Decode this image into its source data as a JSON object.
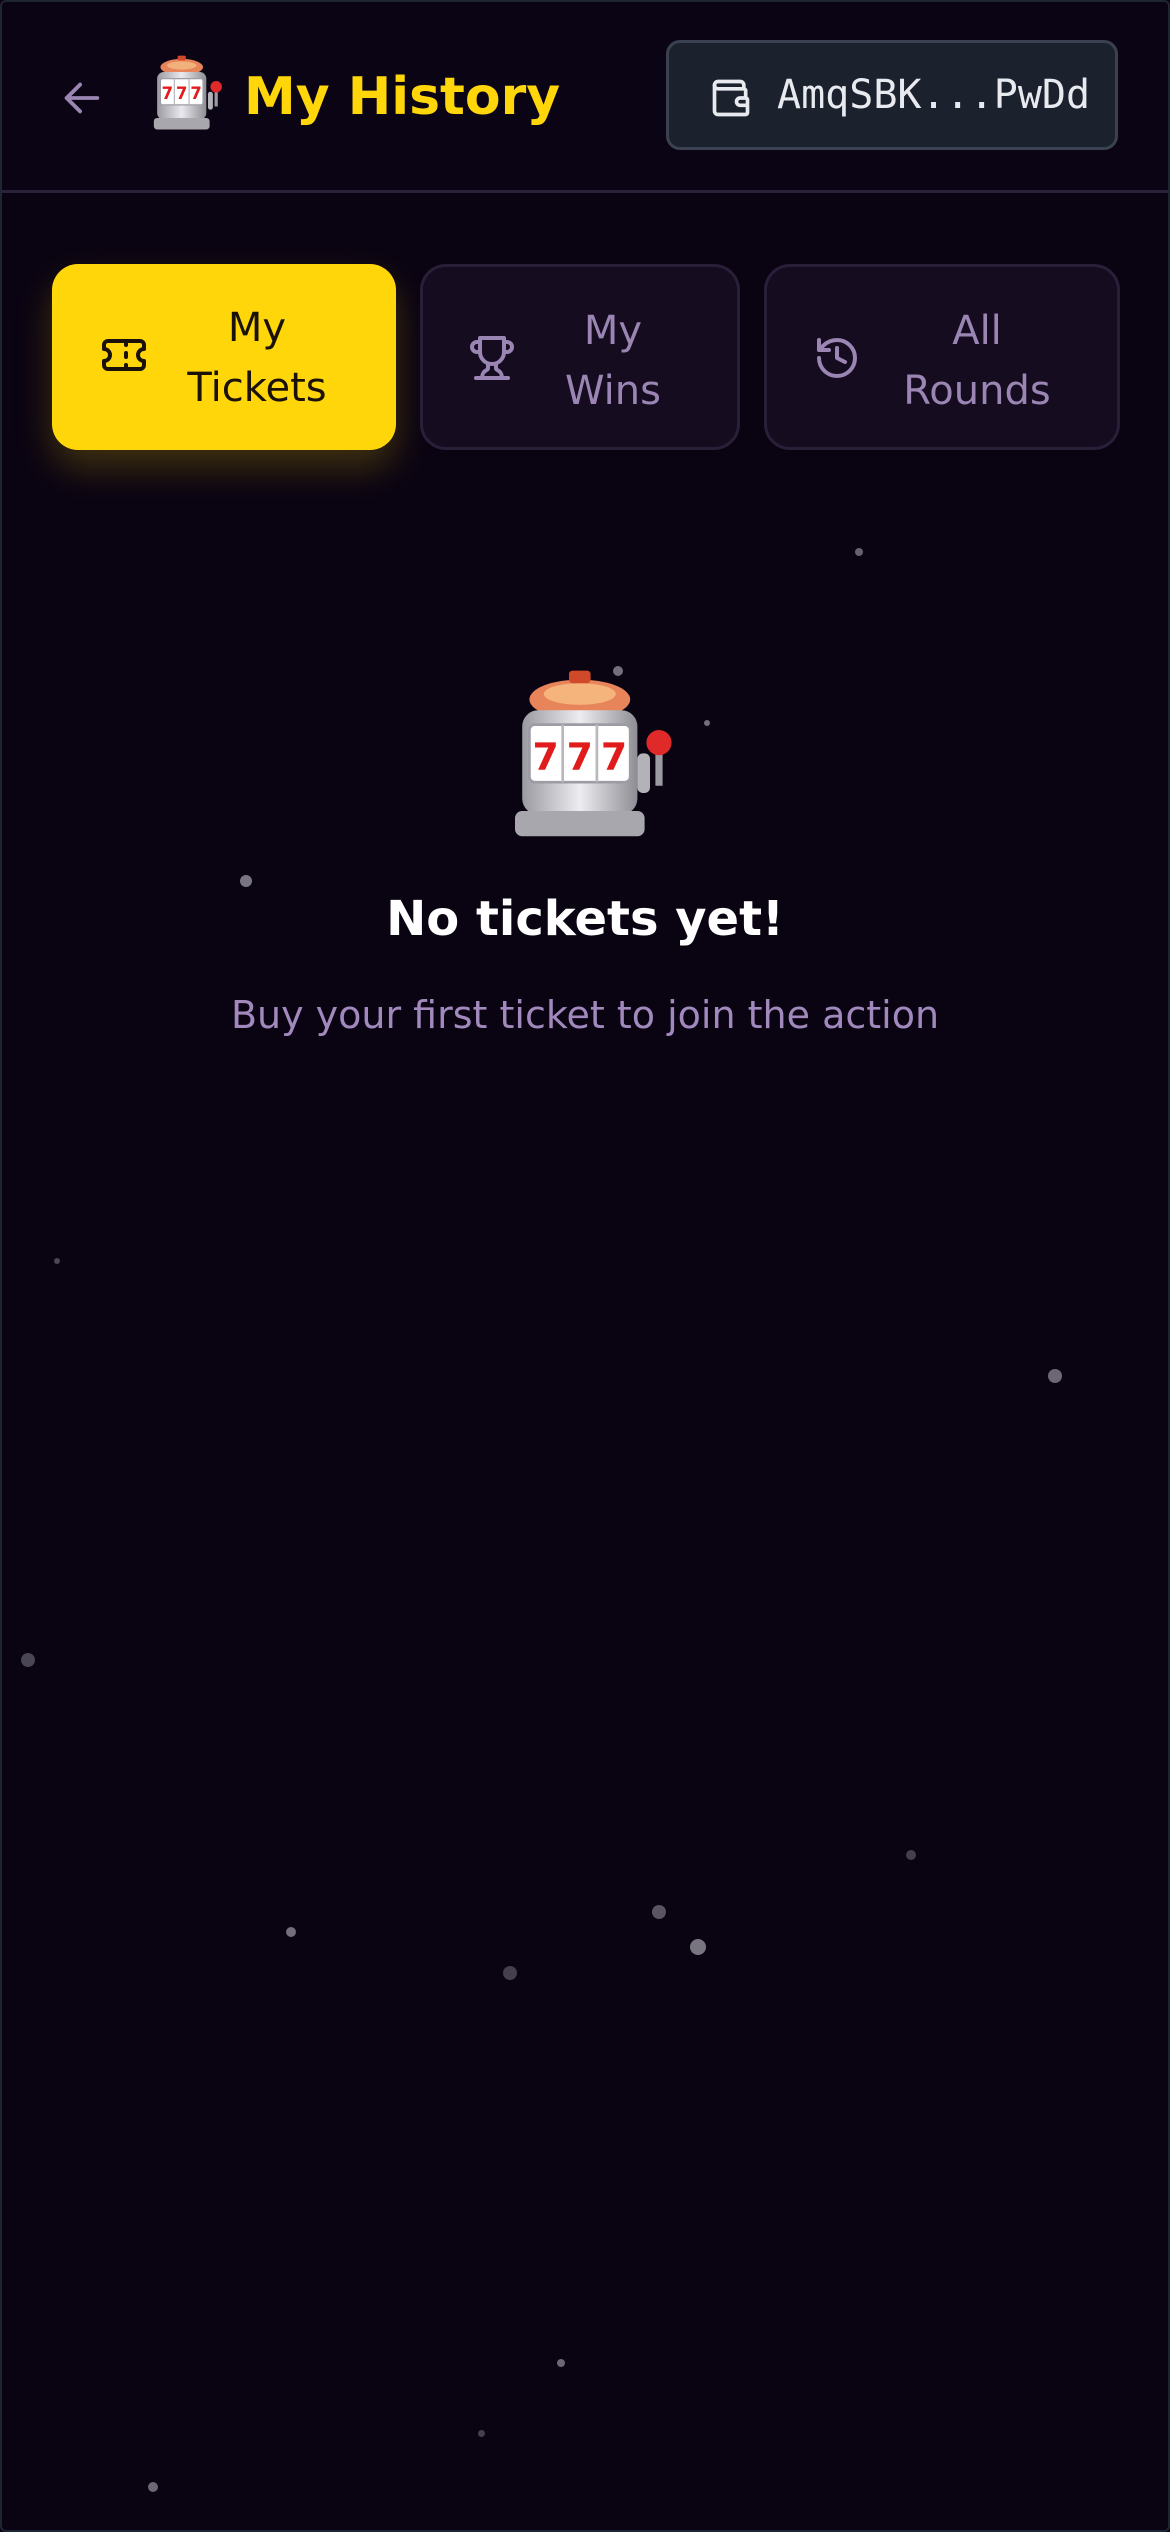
{
  "header": {
    "back_icon": "arrow-left-icon",
    "logo_icon": "slot-machine-icon",
    "title": "My History",
    "wallet": {
      "icon": "wallet-icon",
      "address": "AmqSBK...PwDd"
    }
  },
  "tabs": [
    {
      "label": "My\nTickets",
      "icon": "ticket-icon",
      "active": true
    },
    {
      "label": "My\nWins",
      "icon": "trophy-icon",
      "active": false
    },
    {
      "label": "All\nRounds",
      "icon": "history-icon",
      "active": false
    }
  ],
  "empty_state": {
    "icon": "slot-machine-icon",
    "title": "No tickets yet!",
    "subtitle": "Buy your first ticket to join the action"
  },
  "colors": {
    "background": "#0a0312",
    "accent": "#ffd60a",
    "muted_text": "#9a85b3"
  }
}
